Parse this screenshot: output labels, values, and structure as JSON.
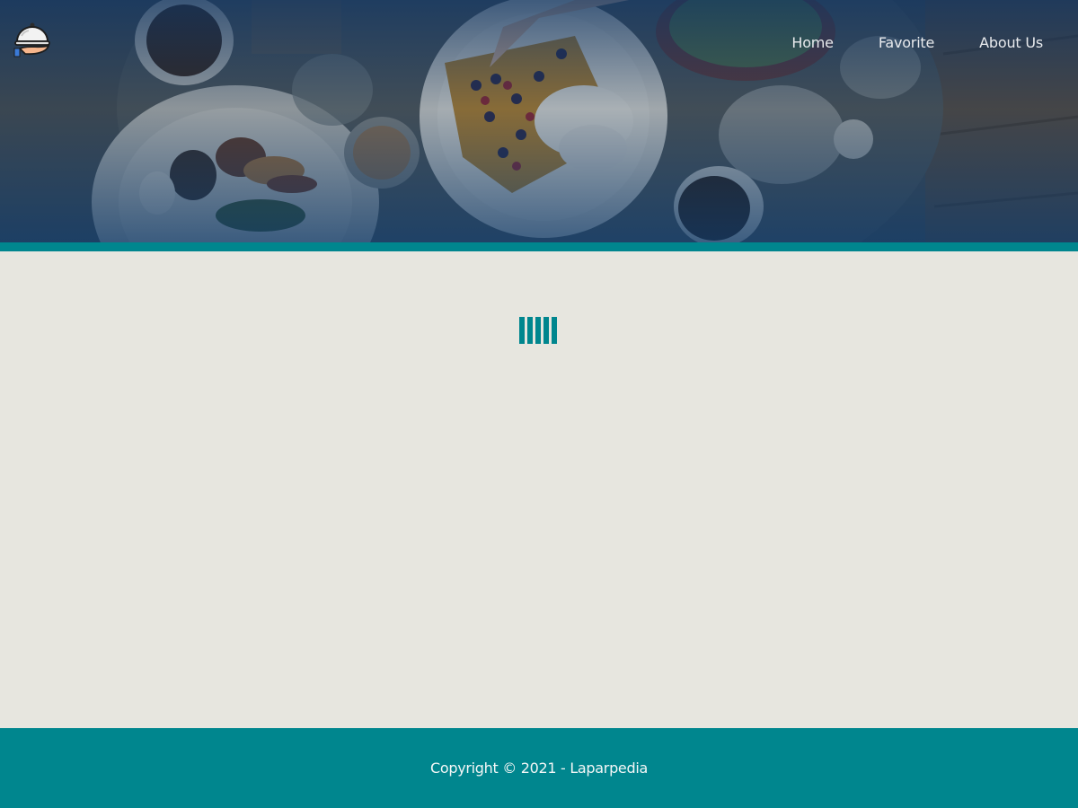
{
  "brand": {
    "logo_icon": "serving-cloche-icon"
  },
  "nav": {
    "items": [
      {
        "label": "Home"
      },
      {
        "label": "Favorite"
      },
      {
        "label": "About Us"
      }
    ]
  },
  "hero": {
    "image": "breakfast-table-photo"
  },
  "loader": {
    "icon": "loading-bars-icon",
    "bars": 5
  },
  "footer": {
    "copyright": "Copyright © 2021 - Laparpedia"
  },
  "colors": {
    "accent": "#00868e",
    "page_background": "#e7e6df",
    "hero_overlay": "#10406a",
    "nav_text": "#e8eaed"
  }
}
